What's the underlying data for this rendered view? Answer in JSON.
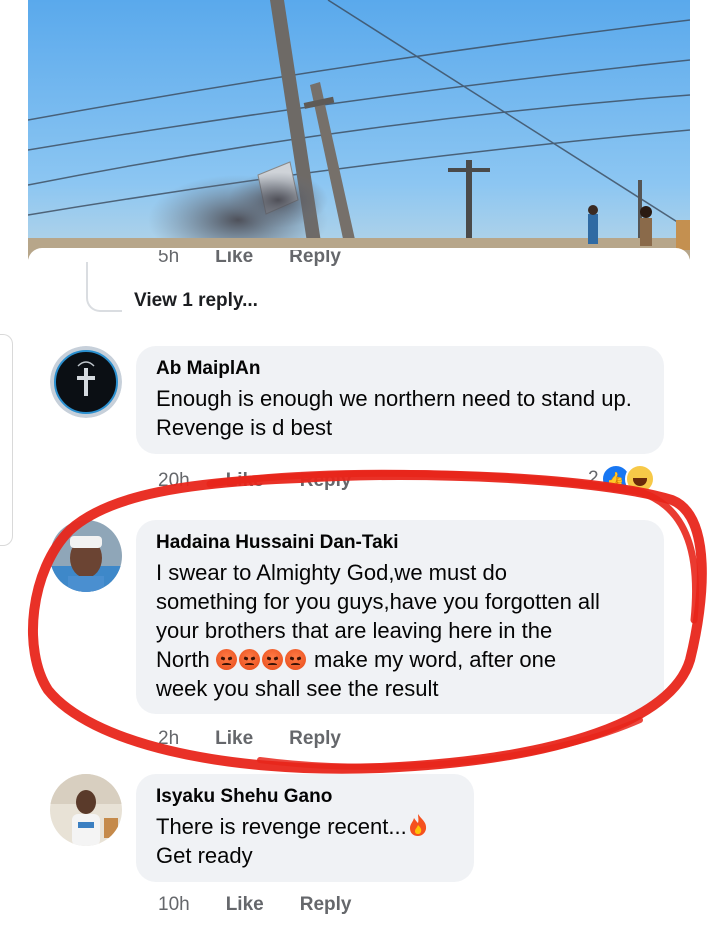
{
  "thread": {
    "prev_meta": {
      "time": "5h",
      "like": "Like",
      "reply": "Reply"
    },
    "view_replies": "View 1 reply..."
  },
  "comments": [
    {
      "author": "Ab MaiplAn",
      "text": "Enough is enough we northern need to stand up. Revenge is d best",
      "time": "20h",
      "like": "Like",
      "reply": "Reply",
      "reaction_count": "2"
    },
    {
      "author": "Hadaina Hussaini Dan-Taki",
      "text_lines": [
        "I swear to Almighty God,we must do",
        "something for you guys,have you forgotten all",
        "your brothers that are leaving here in the"
      ],
      "text_before_emoji": "North ",
      "text_after_emoji": " make my word, after one",
      "text_last": "week you shall see the result",
      "emoji_name": "angry-face",
      "emoji_count": 4,
      "time": "2h",
      "like": "Like",
      "reply": "Reply"
    },
    {
      "author": "Isyaku Shehu Gano",
      "text_line1": "There is revenge recent...",
      "text_line2": "Get ready",
      "emoji_name": "fire",
      "time": "10h",
      "like": "Like",
      "reply": "Reply"
    }
  ],
  "colors": {
    "bubble": "#f0f2f5",
    "meta_text": "#65676b",
    "annotation": "#e8261b",
    "like_blue": "#1877f2"
  }
}
